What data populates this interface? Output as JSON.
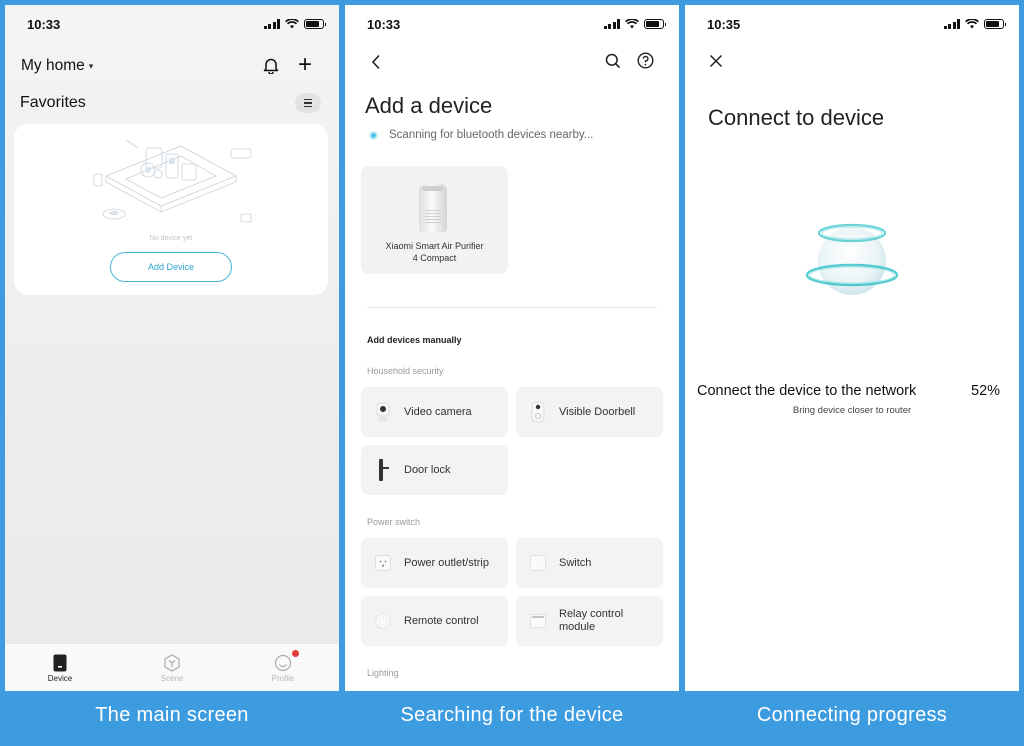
{
  "screens": [
    {
      "id": "main",
      "caption": "The main screen",
      "status_time": "10:33",
      "home_selector": "My home",
      "favorites_title": "Favorites",
      "empty_state_text": "No device yet",
      "add_device_button": "Add Device",
      "tabs": [
        {
          "label": "Device",
          "icon": "device-icon",
          "active": true
        },
        {
          "label": "Scene",
          "icon": "scene-icon",
          "active": false
        },
        {
          "label": "Profile",
          "icon": "profile-icon",
          "active": false,
          "badge": true
        }
      ]
    },
    {
      "id": "search",
      "caption": "Searching for the device",
      "status_time": "10:33",
      "title": "Add a device",
      "scanning_text": "Scanning for bluetooth devices nearby...",
      "found_device": {
        "name": "Xiaomi Smart Air Purifier 4 Compact",
        "icon": "air-purifier-icon"
      },
      "manual_heading": "Add devices manually",
      "categories": [
        {
          "name": "Household security",
          "items": [
            {
              "label": "Video camera",
              "icon": "camera-icon"
            },
            {
              "label": "Visible Doorbell",
              "icon": "doorbell-icon"
            },
            {
              "label": "Door lock",
              "icon": "door-lock-icon"
            }
          ]
        },
        {
          "name": "Power switch",
          "items": [
            {
              "label": "Power outlet/strip",
              "icon": "power-outlet-icon"
            },
            {
              "label": "Switch",
              "icon": "switch-icon"
            },
            {
              "label": "Remote control",
              "icon": "remote-control-icon"
            },
            {
              "label": "Relay control module",
              "icon": "relay-module-icon"
            }
          ]
        },
        {
          "name": "Lighting",
          "items": []
        }
      ]
    },
    {
      "id": "connect",
      "caption": "Connecting progress",
      "status_time": "10:35",
      "title": "Connect to device",
      "progress_text": "Connect the device to the network",
      "progress_percent": "52%",
      "hint": "Bring device closer to router"
    }
  ],
  "colors": {
    "background_blue": "#3d9be0",
    "accent_cyan": "#2fa4cc",
    "badge_red": "#e23b3b"
  }
}
